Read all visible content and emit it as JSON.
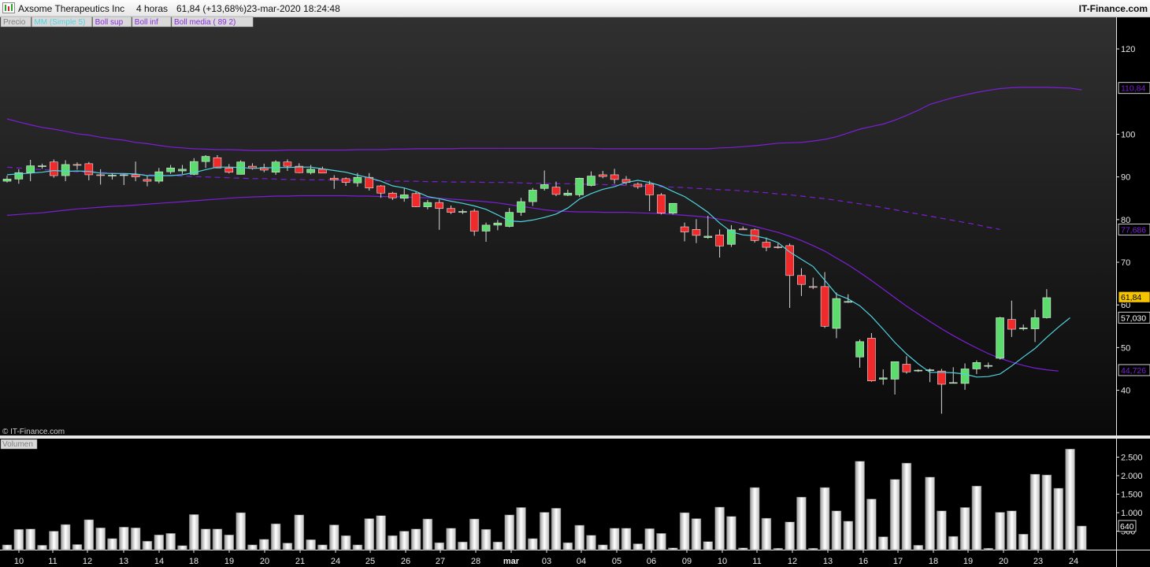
{
  "header": {
    "title": "Axsome Therapeutics Inc",
    "timeframe": "4 horas",
    "quote": "61,84 (+13,68%)",
    "datetime": "23-mar-2020 18:24:48",
    "brand": "IT-Finance.com"
  },
  "watermark": "© IT-Finance.com",
  "colors": {
    "up": "#5ddc6e",
    "down": "#f02a2a",
    "mm": "#4fd3e0",
    "boll": "#7d1ed6",
    "last": "#f5c400",
    "bg": "#000000"
  },
  "legend": [
    {
      "label": "Precio",
      "color": "#7f7f7f"
    },
    {
      "label": "MM (Simple 5)",
      "color": "#4fd3e0"
    },
    {
      "label": "Boll sup",
      "color": "#8a2be2"
    },
    {
      "label": "Boll inf",
      "color": "#8a2be2"
    },
    {
      "label": "Boll media ( 89 2)",
      "color": "#8a2be2"
    }
  ],
  "volume_label": "Volumen",
  "chart_data": [
    {
      "type": "candlestick",
      "title": "Axsome Therapeutics Inc",
      "y_ticks": [
        120,
        100,
        90,
        80,
        70,
        60,
        50,
        40
      ],
      "ylim": [
        29.4,
        127.4
      ],
      "x_labels": [
        "10",
        "11",
        "12",
        "13",
        "14",
        "18",
        "19",
        "20",
        "21",
        "24",
        "25",
        "26",
        "27",
        "28",
        "mar",
        "03",
        "04",
        "05",
        "06",
        "09",
        "10",
        "11",
        "12",
        "13",
        "16",
        "17",
        "18",
        "19",
        "20",
        "23",
        "24"
      ],
      "price_badges": [
        {
          "label": "110,84",
          "value": 110.84,
          "color": "#7d1ed6"
        },
        {
          "label": "77,686",
          "value": 77.686,
          "color": "#7d1ed6"
        },
        {
          "label": "61,84",
          "value": 61.84,
          "color": "#f5c400"
        },
        {
          "label": "57,030",
          "value": 57.03,
          "color": "#4fd3e0"
        },
        {
          "label": "44,726",
          "value": 44.726,
          "color": "#7d1ed6"
        }
      ],
      "ohlc": [
        [
          89.0,
          90.3,
          88.7,
          89.5
        ],
        [
          89.5,
          91.8,
          88.4,
          91.0
        ],
        [
          91.0,
          94.0,
          89.0,
          92.6
        ],
        [
          92.6,
          93.1,
          91.9,
          92.6
        ],
        [
          93.5,
          94.1,
          89.8,
          90.3
        ],
        [
          90.3,
          93.9,
          89.0,
          92.9
        ],
        [
          92.9,
          93.4,
          91.7,
          92.8
        ],
        [
          93.1,
          93.5,
          89.2,
          90.5
        ],
        [
          90.5,
          91.8,
          88.2,
          90.4
        ],
        [
          90.4,
          90.8,
          89.4,
          90.4
        ],
        [
          90.4,
          90.6,
          88.1,
          90.5
        ],
        [
          90.5,
          93.6,
          89.0,
          90.0
        ],
        [
          89.4,
          90.4,
          87.8,
          89.0
        ],
        [
          89.0,
          92.1,
          88.5,
          91.2
        ],
        [
          91.2,
          92.8,
          90.7,
          92.1
        ],
        [
          91.4,
          92.8,
          90.7,
          91.8
        ],
        [
          90.6,
          94.4,
          90.4,
          93.6
        ],
        [
          93.6,
          95.1,
          92.1,
          94.8
        ],
        [
          94.5,
          95.1,
          92.1,
          92.1
        ],
        [
          92.1,
          93.0,
          90.8,
          91.1
        ],
        [
          90.6,
          93.9,
          90.6,
          93.5
        ],
        [
          92.5,
          93.2,
          91.7,
          92.0
        ],
        [
          92.2,
          93.1,
          91.1,
          91.6
        ],
        [
          91.1,
          93.9,
          90.5,
          93.5
        ],
        [
          93.5,
          94.1,
          91.4,
          92.5
        ],
        [
          92.5,
          93.2,
          90.9,
          91.0
        ],
        [
          91.0,
          92.8,
          90.6,
          91.8
        ],
        [
          91.8,
          92.4,
          90.9,
          90.9
        ],
        [
          89.7,
          90.4,
          87.2,
          89.3
        ],
        [
          89.6,
          89.9,
          87.9,
          88.7
        ],
        [
          88.6,
          90.9,
          87.7,
          89.9
        ],
        [
          89.9,
          90.9,
          86.8,
          87.4
        ],
        [
          87.9,
          88.1,
          85.1,
          86.2
        ],
        [
          86.2,
          86.5,
          84.6,
          85.1
        ],
        [
          85.0,
          87.4,
          84.2,
          85.8
        ],
        [
          86.1,
          86.7,
          82.9,
          83.0
        ],
        [
          83.0,
          84.6,
          82.4,
          84.0
        ],
        [
          84.0,
          84.7,
          77.6,
          82.6
        ],
        [
          82.6,
          83.3,
          81.3,
          81.7
        ],
        [
          81.8,
          82.4,
          81.3,
          81.9
        ],
        [
          82.0,
          82.5,
          76.2,
          77.3
        ],
        [
          77.3,
          79.3,
          74.8,
          78.7
        ],
        [
          78.7,
          79.9,
          77.5,
          79.2
        ],
        [
          78.4,
          82.7,
          78.2,
          81.7
        ],
        [
          81.7,
          85.1,
          80.9,
          84.2
        ],
        [
          84.2,
          87.4,
          83.2,
          86.9
        ],
        [
          87.3,
          91.5,
          86.8,
          88.2
        ],
        [
          87.6,
          88.9,
          85.5,
          85.9
        ],
        [
          85.7,
          87.0,
          85.5,
          86.2
        ],
        [
          85.8,
          89.8,
          85.3,
          89.7
        ],
        [
          88.0,
          91.3,
          87.8,
          90.2
        ],
        [
          90.5,
          91.4,
          89.7,
          90.1
        ],
        [
          90.5,
          91.9,
          88.4,
          89.4
        ],
        [
          89.4,
          90.2,
          88.2,
          88.7
        ],
        [
          88.3,
          88.7,
          87.2,
          87.7
        ],
        [
          88.3,
          89.1,
          82.0,
          85.8
        ],
        [
          85.8,
          86.2,
          81.2,
          81.5
        ],
        [
          81.5,
          83.8,
          81.2,
          83.8
        ],
        [
          78.3,
          79.3,
          74.9,
          77.1
        ],
        [
          77.7,
          80.1,
          74.5,
          76.3
        ],
        [
          75.8,
          80.9,
          75.5,
          76.1
        ],
        [
          76.4,
          77.7,
          71.1,
          73.8
        ],
        [
          74.2,
          78.7,
          73.6,
          77.6
        ],
        [
          77.8,
          78.4,
          77.6,
          77.6
        ],
        [
          77.6,
          77.9,
          74.6,
          75.1
        ],
        [
          74.7,
          75.8,
          72.6,
          73.5
        ],
        [
          73.6,
          74.4,
          73.2,
          73.5
        ],
        [
          73.9,
          74.4,
          59.3,
          66.9
        ],
        [
          66.9,
          68.6,
          62.1,
          64.8
        ],
        [
          64.3,
          66.4,
          63.7,
          64.2
        ],
        [
          64.3,
          67.7,
          54.6,
          55.0
        ],
        [
          54.5,
          62.9,
          52.2,
          61.5
        ],
        [
          60.8,
          62.5,
          60.5,
          60.8
        ],
        [
          47.8,
          51.9,
          45.3,
          51.4
        ],
        [
          52.2,
          53.4,
          42.0,
          42.2
        ],
        [
          42.6,
          44.9,
          41.3,
          42.9
        ],
        [
          42.6,
          46.7,
          39.0,
          46.7
        ],
        [
          46.1,
          48.0,
          43.9,
          44.3
        ],
        [
          44.6,
          44.9,
          44.3,
          44.7
        ],
        [
          44.6,
          45.1,
          41.9,
          44.8
        ],
        [
          44.5,
          45.0,
          34.5,
          41.4
        ],
        [
          41.7,
          45.4,
          41.7,
          41.8
        ],
        [
          41.6,
          46.3,
          40.1,
          45.0
        ],
        [
          45.0,
          47.0,
          43.8,
          46.5
        ],
        [
          45.8,
          46.5,
          45.1,
          45.8
        ],
        [
          47.5,
          57.2,
          47.2,
          57.0
        ],
        [
          56.6,
          61.0,
          52.5,
          54.3
        ],
        [
          54.4,
          55.4,
          54.0,
          54.6
        ],
        [
          54.4,
          58.9,
          51.3,
          57.0
        ],
        [
          57.0,
          63.7,
          56.8,
          61.7
        ]
      ],
      "series": [
        {
          "name": "MM (Simple 5)",
          "values": [
            90.5,
            90.7,
            90.9,
            91.1,
            91.5,
            91.3,
            91.4,
            91.3,
            90.9,
            90.8,
            90.8,
            90.7,
            90.3,
            90.3,
            90.3,
            90.5,
            91.0,
            91.7,
            92.3,
            92.3,
            92.2,
            92.0,
            92.1,
            92.2,
            92.2,
            92.3,
            92.3,
            91.9,
            91.5,
            91.1,
            90.4,
            89.8,
            89.0,
            87.9,
            87.4,
            86.6,
            85.4,
            84.9,
            84.3,
            83.8,
            83.2,
            82.4,
            81.1,
            79.7,
            79.5,
            79.9,
            80.5,
            81.3,
            82.7,
            84.8,
            86.1,
            87.1,
            87.7,
            88.7,
            89.2,
            88.7,
            87.9,
            86.6,
            85.4,
            83.6,
            81.7,
            79.2,
            77.1,
            76.4,
            76.2,
            75.6,
            74.6,
            72.4,
            70.7,
            69.0,
            65.8,
            62.5,
            61.4,
            59.8,
            57.3,
            54.3,
            51.2,
            48.5,
            46.2,
            44.2,
            44.2,
            44.1,
            43.8,
            43.1,
            43.2,
            43.8,
            45.7,
            47.8,
            49.8,
            52.4,
            54.8,
            57.0
          ]
        },
        {
          "name": "Boll sup",
          "values": [
            103.6,
            102.9,
            102.2,
            101.6,
            101.2,
            100.7,
            100.1,
            99.8,
            99.3,
            98.9,
            98.6,
            98.1,
            97.8,
            97.4,
            97.0,
            96.8,
            96.6,
            96.5,
            96.4,
            96.4,
            96.3,
            96.2,
            96.2,
            96.2,
            96.3,
            96.3,
            96.3,
            96.3,
            96.3,
            96.3,
            96.4,
            96.4,
            96.4,
            96.5,
            96.5,
            96.6,
            96.6,
            96.6,
            96.6,
            96.7,
            96.7,
            96.7,
            96.7,
            96.7,
            96.7,
            96.7,
            96.7,
            96.7,
            96.7,
            96.7,
            96.7,
            96.6,
            96.6,
            96.6,
            96.6,
            96.6,
            96.6,
            96.6,
            96.6,
            96.6,
            96.6,
            96.8,
            96.9,
            97.1,
            97.3,
            97.6,
            97.9,
            98.0,
            98.1,
            98.4,
            98.8,
            99.4,
            100.3,
            101.2,
            101.8,
            102.4,
            103.3,
            104.4,
            105.6,
            107.0,
            107.8,
            108.6,
            109.2,
            109.8,
            110.3,
            110.7,
            110.9,
            111.0,
            111.0,
            111.0,
            110.9,
            110.8,
            110.4
          ]
        },
        {
          "name": "Boll media ( 89 2)",
          "values": [
            92.3,
            92.1,
            91.9,
            91.7,
            91.6,
            91.4,
            91.2,
            91.1,
            91.0,
            90.9,
            90.7,
            90.6,
            90.5,
            90.4,
            90.3,
            90.2,
            90.1,
            90.0,
            89.9,
            89.8,
            89.7,
            89.6,
            89.6,
            89.5,
            89.4,
            89.4,
            89.3,
            89.3,
            89.3,
            89.2,
            89.2,
            89.1,
            89.1,
            89.0,
            89.0,
            89.0,
            88.9,
            88.9,
            88.8,
            88.8,
            88.8,
            88.7,
            88.7,
            88.7,
            88.6,
            88.5,
            88.5,
            88.4,
            88.4,
            88.3,
            88.3,
            88.2,
            88.1,
            88.0,
            87.9,
            87.8,
            87.7,
            87.6,
            87.5,
            87.3,
            87.2,
            87.0,
            86.9,
            86.7,
            86.5,
            86.3,
            86.0,
            85.8,
            85.5,
            85.2,
            84.9,
            84.5,
            84.1,
            83.7,
            83.3,
            82.8,
            82.3,
            81.8,
            81.3,
            80.8,
            80.3,
            79.8,
            79.3,
            78.8,
            78.2,
            77.7
          ]
        },
        {
          "name": "Boll inf",
          "values": [
            81.0,
            81.2,
            81.4,
            81.6,
            81.9,
            82.2,
            82.5,
            82.7,
            82.9,
            83.1,
            83.2,
            83.4,
            83.6,
            83.8,
            84.0,
            84.2,
            84.4,
            84.6,
            84.8,
            85.0,
            85.2,
            85.3,
            85.4,
            85.5,
            85.5,
            85.6,
            85.6,
            85.6,
            85.6,
            85.6,
            85.5,
            85.5,
            85.4,
            85.4,
            85.3,
            85.2,
            85.1,
            85.0,
            84.8,
            84.6,
            84.4,
            84.2,
            83.9,
            83.5,
            83.1,
            82.7,
            82.3,
            82.0,
            81.9,
            81.8,
            81.8,
            81.7,
            81.7,
            81.7,
            81.6,
            81.5,
            81.4,
            81.2,
            81.0,
            80.8,
            80.5,
            80.1,
            79.6,
            79.0,
            78.4,
            77.7,
            77.0,
            76.1,
            75.1,
            73.9,
            72.6,
            71.0,
            69.4,
            67.6,
            65.7,
            63.7,
            61.7,
            59.7,
            57.9,
            56.1,
            54.4,
            52.8,
            51.3,
            49.9,
            48.6,
            47.5,
            46.6,
            45.8,
            45.2,
            44.8,
            44.5
          ]
        }
      ]
    },
    {
      "type": "bar",
      "title": "Volumen",
      "y_ticks": [
        2500,
        2000,
        1500,
        1000,
        500
      ],
      "y_tick_labels": [
        "2.500",
        "2.000",
        "1.500",
        "1.000",
        "500"
      ],
      "ylim": [
        0,
        3000
      ],
      "last_badge": "640",
      "values": [
        130,
        550,
        560,
        120,
        500,
        680,
        140,
        810,
        590,
        300,
        610,
        590,
        230,
        400,
        440,
        110,
        950,
        560,
        560,
        400,
        1000,
        130,
        280,
        700,
        180,
        940,
        270,
        130,
        670,
        380,
        130,
        840,
        920,
        380,
        500,
        560,
        830,
        190,
        580,
        210,
        830,
        550,
        210,
        940,
        1140,
        300,
        1010,
        1120,
        190,
        660,
        390,
        130,
        580,
        580,
        160,
        570,
        440,
        50,
        1000,
        840,
        220,
        1150,
        900,
        50,
        1680,
        850,
        40,
        750,
        1420,
        40,
        1680,
        1050,
        770,
        2390,
        1370,
        350,
        1900,
        2340,
        120,
        1960,
        1050,
        360,
        1140,
        1720,
        40,
        1010,
        1050,
        420,
        2040,
        2020,
        1660,
        2720,
        640
      ]
    }
  ]
}
